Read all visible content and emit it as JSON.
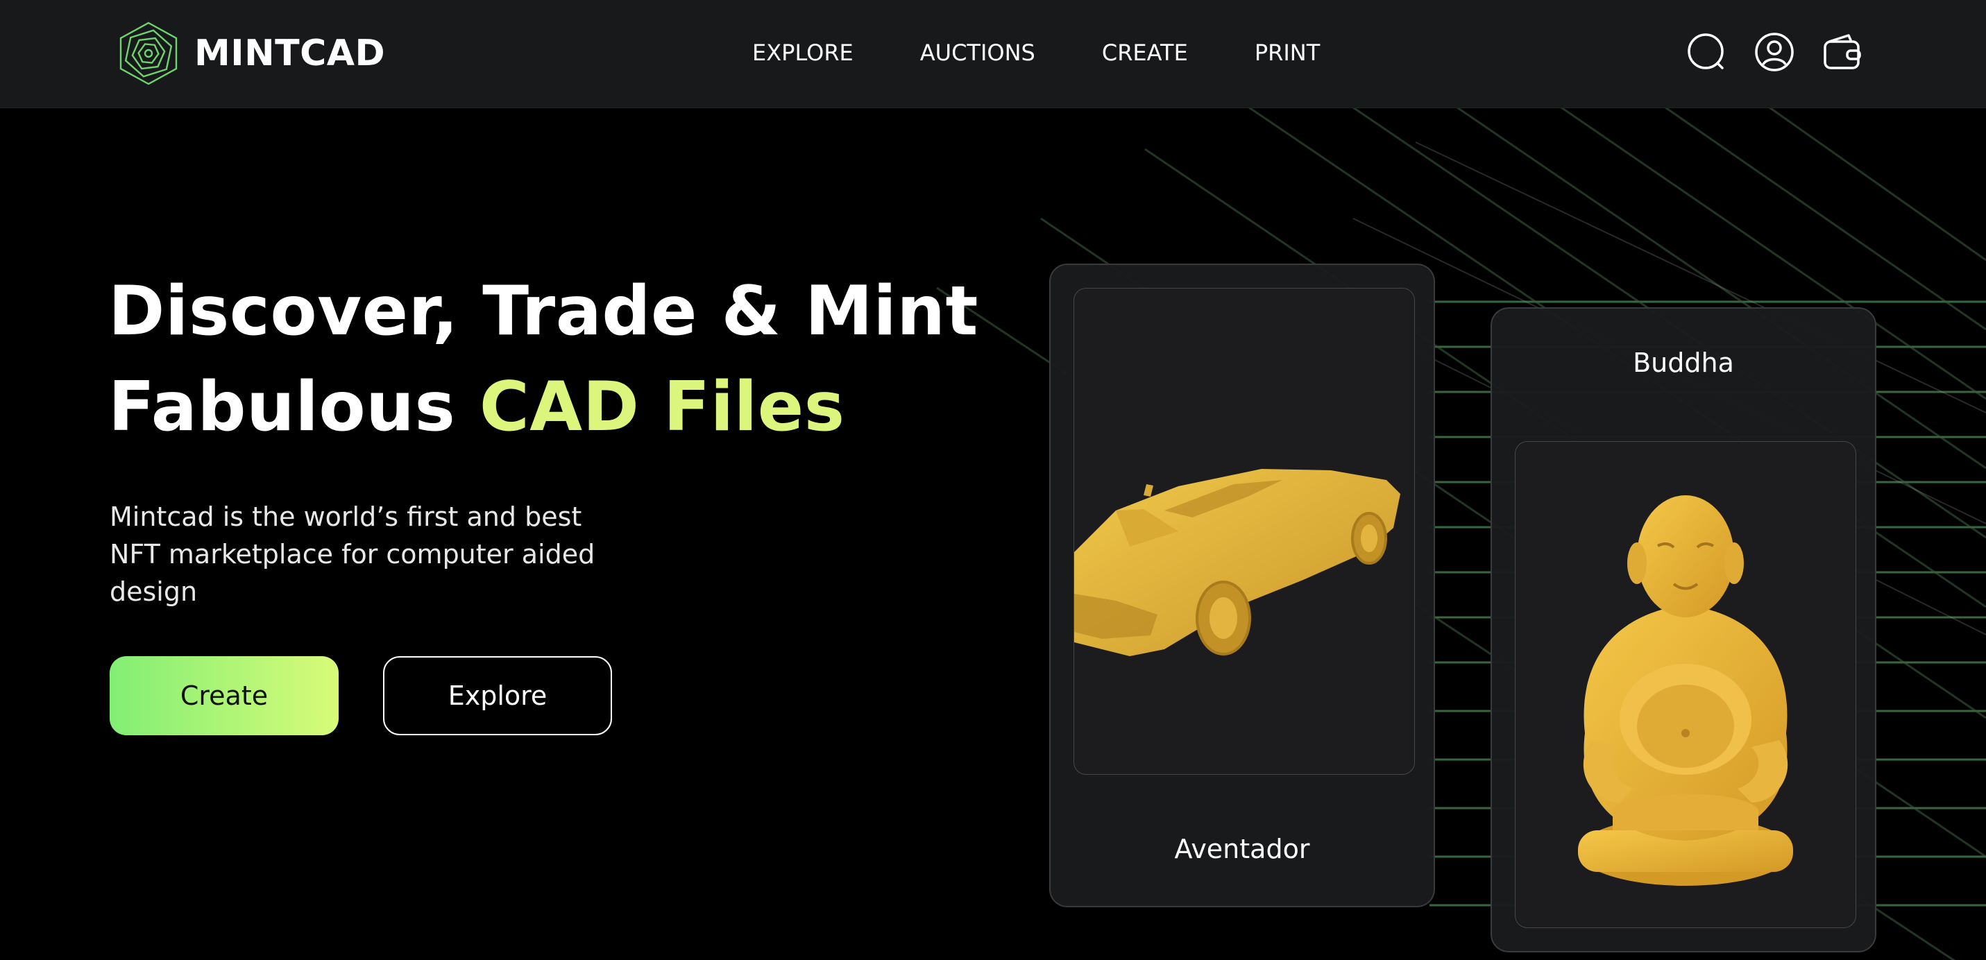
{
  "brand": {
    "name": "MINTCAD",
    "logo_icon": "spiral-hexagon-logo"
  },
  "nav": {
    "links": [
      "EXPLORE",
      "AUCTIONS",
      "CREATE",
      "PRINT"
    ],
    "icons": [
      "search-icon",
      "user-icon",
      "wallet-icon"
    ]
  },
  "hero": {
    "title_line1": "Discover, Trade & Mint",
    "title_line2_prefix": "Fabulous ",
    "title_line2_accent": "CAD Files",
    "subtitle": "Mintcad is the world’s first and best NFT marketplace for computer aided design",
    "create_label": "Create",
    "explore_label": "Explore"
  },
  "cards": [
    {
      "name": "Aventador",
      "image": "gold-car-model"
    },
    {
      "name": "Buddha",
      "image": "gold-buddha-statue"
    }
  ],
  "colors": {
    "accent": "#dcf57c",
    "gold": "#e6b93b",
    "grid_green": "#4d8a52",
    "navbar_bg": "#18191b",
    "button_gradient": [
      "#82ee74",
      "#d8fb78"
    ]
  }
}
